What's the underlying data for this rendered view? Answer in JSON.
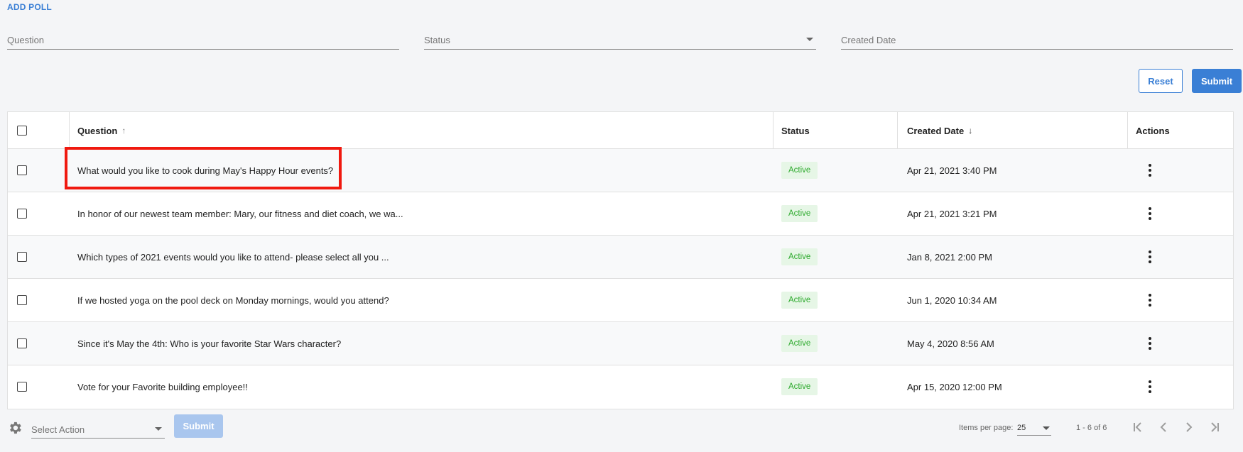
{
  "header": {
    "add_poll_label": "ADD POLL"
  },
  "filters": {
    "question_placeholder": "Question",
    "status_placeholder": "Status",
    "created_date_placeholder": "Created Date",
    "reset_label": "Reset",
    "submit_label": "Submit"
  },
  "table": {
    "columns": {
      "question": "Question",
      "status": "Status",
      "created_date": "Created Date",
      "actions": "Actions"
    },
    "sort": {
      "question": "asc",
      "created_date": "desc"
    },
    "rows": [
      {
        "question": "What would you like to cook during May's Happy Hour events?",
        "status": "Active",
        "created_date": "Apr 21, 2021 3:40 PM"
      },
      {
        "question": "In honor of our newest team member: Mary, our fitness and diet coach, we wa...",
        "status": "Active",
        "created_date": "Apr 21, 2021 3:21 PM"
      },
      {
        "question": "Which types of 2021 events would you like to attend- please select all you ...",
        "status": "Active",
        "created_date": "Jan 8, 2021 2:00 PM"
      },
      {
        "question": "If we hosted yoga on the pool deck on Monday mornings, would you attend?",
        "status": "Active",
        "created_date": "Jun 1, 2020 10:34 AM"
      },
      {
        "question": "Since it's May the 4th: Who is your favorite Star Wars character?",
        "status": "Active",
        "created_date": "May 4, 2020 8:56 AM"
      },
      {
        "question": "Vote for your Favorite building employee!!",
        "status": "Active",
        "created_date": "Apr 15, 2020 12:00 PM"
      }
    ]
  },
  "footer": {
    "select_action_placeholder": "Select Action",
    "submit_label": "Submit",
    "items_per_page_label": "Items per page:",
    "items_per_page_value": "25",
    "range_label": "1 - 6 of 6"
  },
  "colors": {
    "accent": "#3a7fd5",
    "active_badge_bg": "#e6f6e6",
    "active_badge_text": "#2eaa2e",
    "highlight": "#f0190f"
  },
  "icons": [
    "arrow-up-icon",
    "arrow-down-icon",
    "kebab-menu-icon",
    "gear-icon",
    "first-page-icon",
    "prev-page-icon",
    "next-page-icon",
    "last-page-icon",
    "chevron-down-icon"
  ]
}
